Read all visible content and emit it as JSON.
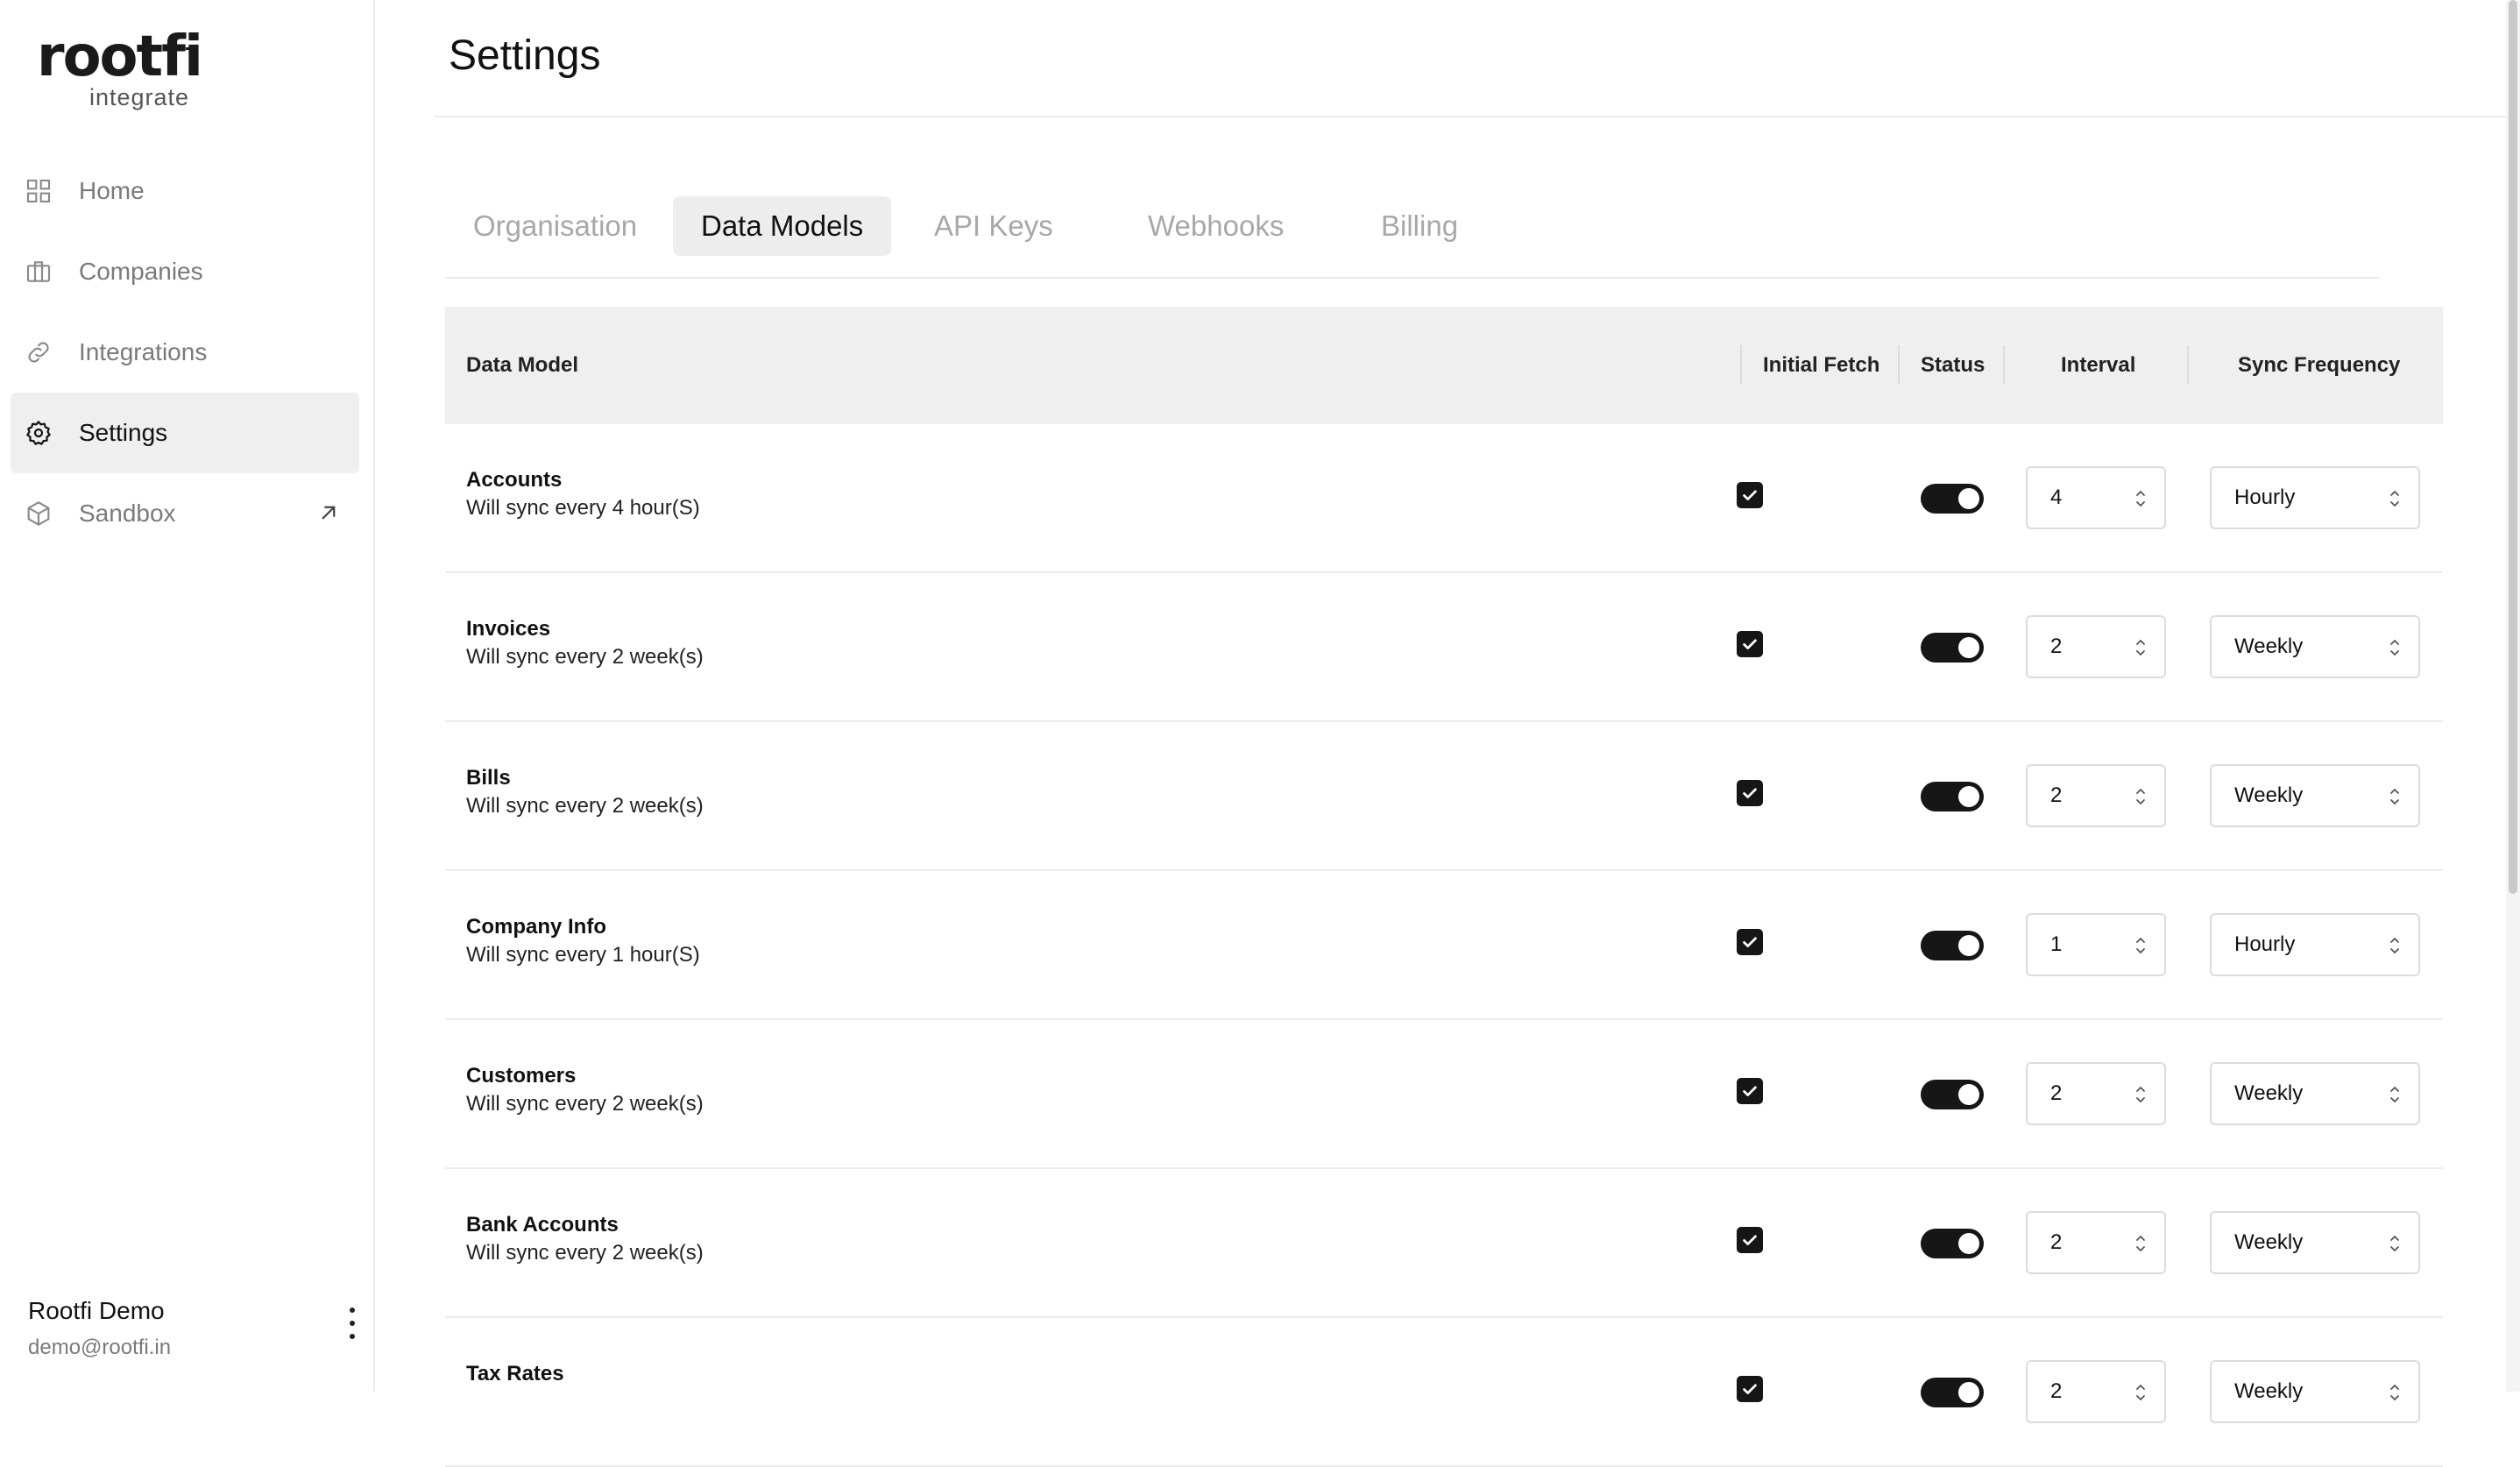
{
  "sidebar": {
    "logo_word": "rootfi",
    "logo_sub": "integrate",
    "items": [
      {
        "label": "Home",
        "icon": "grid-icon"
      },
      {
        "label": "Companies",
        "icon": "briefcase-icon"
      },
      {
        "label": "Integrations",
        "icon": "link-icon"
      },
      {
        "label": "Settings",
        "icon": "gear-icon"
      },
      {
        "label": "Sandbox",
        "icon": "cube-icon"
      }
    ],
    "active_item": "Settings",
    "user": {
      "name": "Rootfi Demo",
      "email": "demo@rootfi.in"
    }
  },
  "page": {
    "title": "Settings"
  },
  "tabs": [
    {
      "label": "Organisation"
    },
    {
      "label": "Data Models"
    },
    {
      "label": "API Keys"
    },
    {
      "label": "Webhooks"
    },
    {
      "label": "Billing"
    }
  ],
  "active_tab": "Data Models",
  "table": {
    "headers": {
      "data_model": "Data Model",
      "initial_fetch": "Initial Fetch",
      "status": "Status",
      "interval": "Interval",
      "sync_frequency": "Sync Frequency"
    },
    "rows": [
      {
        "name": "Accounts",
        "desc": "Will sync every 4 hour(S)",
        "initial_fetch": true,
        "status": true,
        "interval": "4",
        "frequency": "Hourly"
      },
      {
        "name": "Invoices",
        "desc": "Will sync every 2 week(s)",
        "initial_fetch": true,
        "status": true,
        "interval": "2",
        "frequency": "Weekly"
      },
      {
        "name": "Bills",
        "desc": "Will sync every 2 week(s)",
        "initial_fetch": true,
        "status": true,
        "interval": "2",
        "frequency": "Weekly"
      },
      {
        "name": "Company Info",
        "desc": "Will sync every 1 hour(S)",
        "initial_fetch": true,
        "status": true,
        "interval": "1",
        "frequency": "Hourly"
      },
      {
        "name": "Customers",
        "desc": "Will sync every 2 week(s)",
        "initial_fetch": true,
        "status": true,
        "interval": "2",
        "frequency": "Weekly"
      },
      {
        "name": "Bank Accounts",
        "desc": "Will sync every 2 week(s)",
        "initial_fetch": true,
        "status": true,
        "interval": "2",
        "frequency": "Weekly"
      },
      {
        "name": "Tax Rates",
        "desc": "",
        "initial_fetch": true,
        "status": true,
        "interval": "2",
        "frequency": "Weekly"
      }
    ]
  },
  "colors": {
    "accent": "#161616",
    "active_bg": "#efefef",
    "muted_text": "#a8a8a8",
    "border": "#dcdcdc"
  }
}
